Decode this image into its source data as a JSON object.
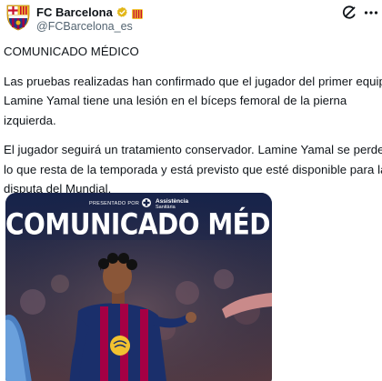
{
  "header": {
    "display_name": "FC Barcelona",
    "handle": "@FCBarcelona_es",
    "verified_icon": "gold-checkmark-icon",
    "affiliate_badge_icon": "catalan-flag-badge-icon",
    "grok_icon": "grok-icon",
    "more_icon": "more-dots-icon"
  },
  "tweet": {
    "title": "COMUNICADO MÉDICO",
    "paragraph1_line1": "Las pruebas realizadas han confirmado que el jugador del primer equipo",
    "paragraph1_line2": "Lamine Yamal tiene una lesión en el bíceps femoral de la pierna",
    "paragraph1_line3": "izquierda.",
    "paragraph2_line1": "El jugador seguirá un tratamiento conservador. Lamine Yamal se perderá",
    "paragraph2_line2": "lo que resta de la temporada y está previsto que esté disponible para la",
    "paragraph2_line3": "disputa del Mundial."
  },
  "media": {
    "presented_by": "PRESENTADO POR",
    "sponsor_name": "Assistència",
    "sponsor_sub": "Sanitària",
    "headline": "COMUNICADO MÉDICO"
  },
  "colors": {
    "text": "#0f1419",
    "secondary_text": "#536471",
    "verified_gold": "#e2b719",
    "barca_blue": "#1b2a55",
    "barca_garnet": "#a50044"
  }
}
